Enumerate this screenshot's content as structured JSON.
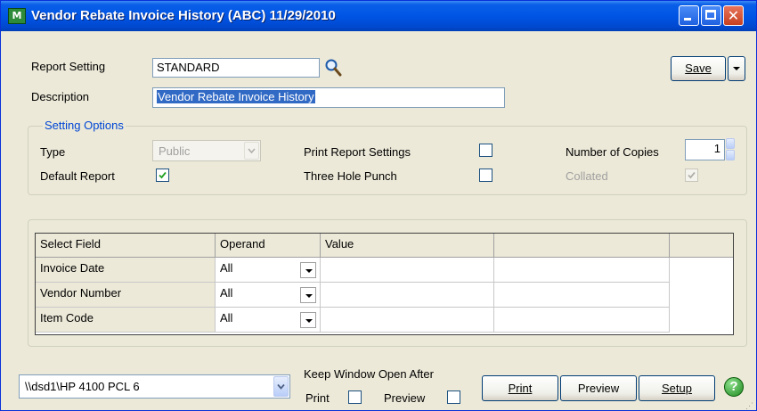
{
  "window": {
    "title": "Vendor Rebate Invoice History (ABC) 11/29/2010",
    "app_icon_label": "M",
    "close_glyph": "✕"
  },
  "report_setting": {
    "label": "Report Setting",
    "value": "STANDARD"
  },
  "description": {
    "label": "Description",
    "value": "Vendor Rebate Invoice History"
  },
  "save_button": {
    "label": "Save"
  },
  "setting_options": {
    "legend": "Setting Options",
    "type_label": "Type",
    "type_value": "Public",
    "default_report_label": "Default Report",
    "default_report_checked": true,
    "print_report_settings_label": "Print Report Settings",
    "print_report_settings_checked": false,
    "three_hole_punch_label": "Three Hole Punch",
    "three_hole_punch_checked": false,
    "number_of_copies_label": "Number of Copies",
    "number_of_copies_value": "1",
    "collated_label": "Collated",
    "collated_checked": true
  },
  "selection_grid": {
    "headers": [
      "Select Field",
      "Operand",
      "Value",
      ""
    ],
    "rows": [
      {
        "field": "Invoice Date",
        "operand": "All",
        "value": ""
      },
      {
        "field": "Vendor Number",
        "operand": "All",
        "value": ""
      },
      {
        "field": "Item Code",
        "operand": "All",
        "value": ""
      }
    ]
  },
  "printer": {
    "value": "\\\\dsd1\\HP 4100 PCL 6"
  },
  "keep_window_open": {
    "label": "Keep Window Open After",
    "print_label": "Print",
    "preview_label": "Preview",
    "print_checked": false,
    "preview_checked": false
  },
  "buttons": {
    "print": "Print",
    "preview": "Preview",
    "setup": "Setup",
    "help": "?"
  },
  "colors": {
    "titlebar": "#0055E5",
    "face": "#ECE9D8",
    "accent": "#0046D5",
    "selection": "#316AC5"
  }
}
